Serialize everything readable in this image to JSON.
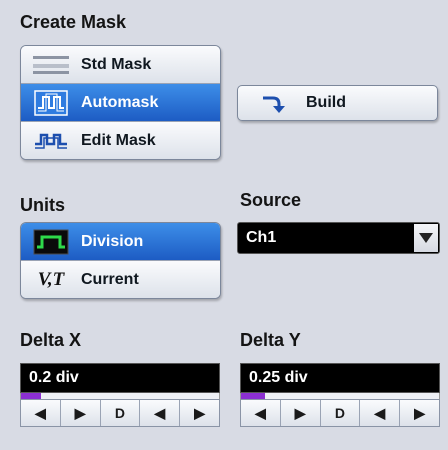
{
  "create_mask": {
    "title": "Create Mask",
    "items": [
      {
        "label": "Std Mask",
        "selected": false,
        "icon": "std-mask-icon"
      },
      {
        "label": "Automask",
        "selected": true,
        "icon": "automask-icon"
      },
      {
        "label": "Edit Mask",
        "selected": false,
        "icon": "edit-mask-icon"
      }
    ],
    "build_label": "Build",
    "build_icon": "curved-arrow-icon"
  },
  "units": {
    "title": "Units",
    "items": [
      {
        "label": "Division",
        "selected": true,
        "icon": "division-icon"
      },
      {
        "label": "Current",
        "selected": false,
        "icon": "vt-icon",
        "icon_text": "V,T"
      }
    ]
  },
  "source": {
    "title": "Source",
    "value": "Ch1"
  },
  "delta_x": {
    "title": "Delta X",
    "value": "0.2 div",
    "level": 0.1,
    "stepper": [
      "◀",
      "▶",
      "D",
      "◀",
      "▶"
    ]
  },
  "delta_y": {
    "title": "Delta Y",
    "value": "0.25 div",
    "level": 0.12,
    "stepper": [
      "◀",
      "▶",
      "D",
      "◀",
      "▶"
    ]
  },
  "colors": {
    "background": "#d8dbe4",
    "selected": "#2a6fd6",
    "field": "#000000",
    "track_fill": "#8b2fd1"
  }
}
